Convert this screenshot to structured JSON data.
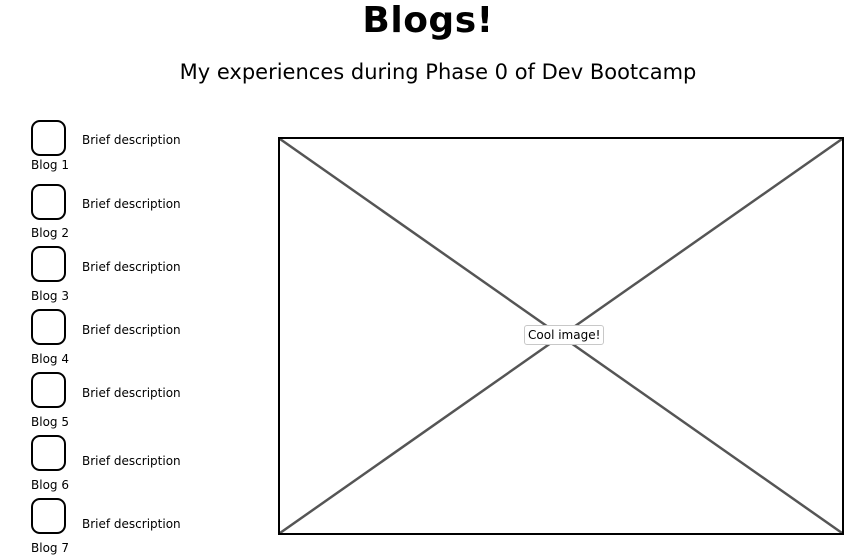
{
  "header": {
    "title": "Blogs!",
    "subtitle": "My experiences during Phase 0 of Dev Bootcamp"
  },
  "blogs": [
    {
      "label": "Blog 1",
      "description": "Brief description"
    },
    {
      "label": "Blog 2",
      "description": "Brief description"
    },
    {
      "label": "Blog 3",
      "description": "Brief description"
    },
    {
      "label": "Blog 4",
      "description": "Brief description"
    },
    {
      "label": "Blog 5",
      "description": "Brief description"
    },
    {
      "label": "Blog 6",
      "description": "Brief description"
    },
    {
      "label": "Blog 7",
      "description": "Brief description"
    }
  ],
  "main_image": {
    "caption": "Cool image!"
  }
}
